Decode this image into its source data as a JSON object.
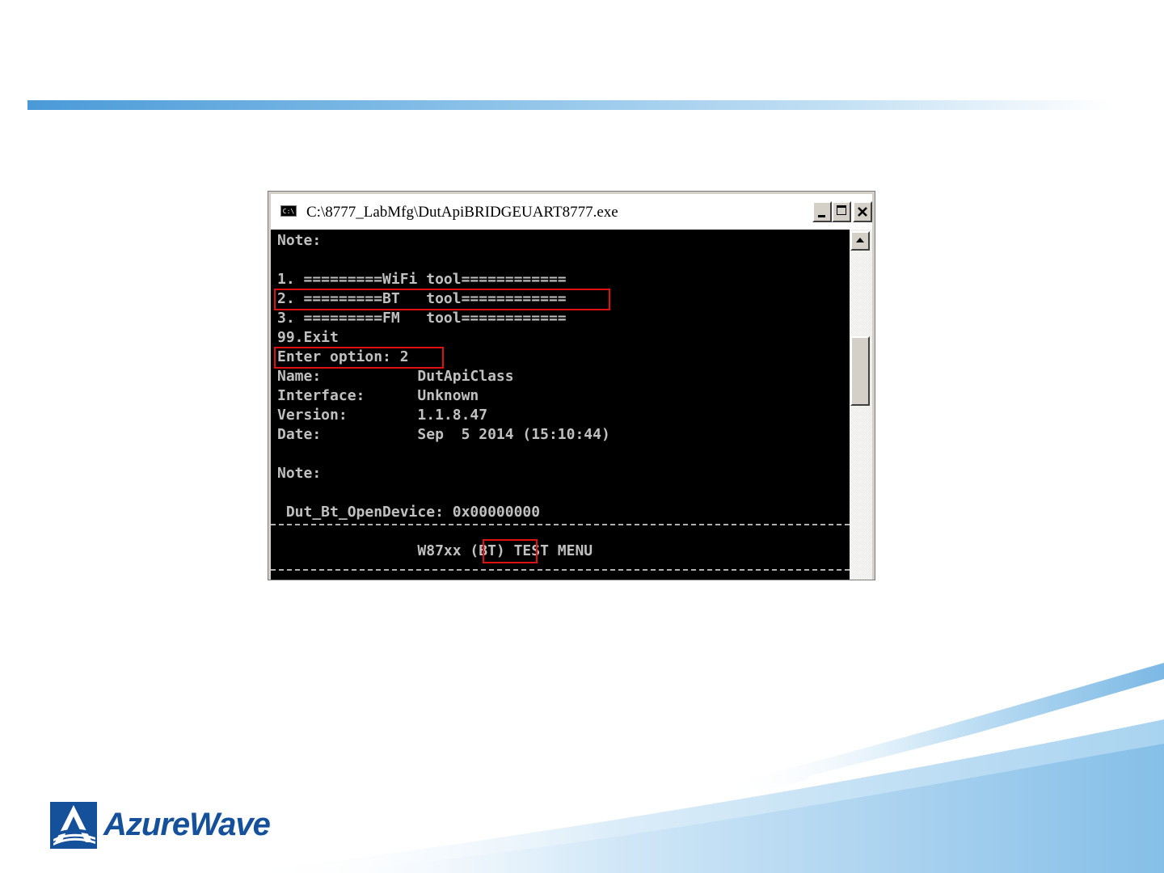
{
  "brand": {
    "name": "AzureWave",
    "primary_color": "#15519a",
    "accent_color": "#4a9ad8"
  },
  "window": {
    "title": "C:\\8777_LabMfg\\DutApiBRIDGEUART8777.exe",
    "icon": "console-icon",
    "icon_text": "C:\\"
  },
  "console": {
    "lines": [
      "Note:",
      "",
      "1. =========WiFi tool============",
      "2. =========BT   tool============",
      "3. =========FM   tool============",
      "99.Exit",
      "Enter option: 2",
      "Name:           DutApiClass",
      "Interface:      Unknown",
      "Version:        1.1.8.47",
      "Date:           Sep  5 2014 (15:10:44)",
      "",
      "Note:",
      "",
      " Dut_Bt_OpenDevice: 0x00000000",
      "",
      "                W87xx (BT) TEST MENU"
    ]
  }
}
